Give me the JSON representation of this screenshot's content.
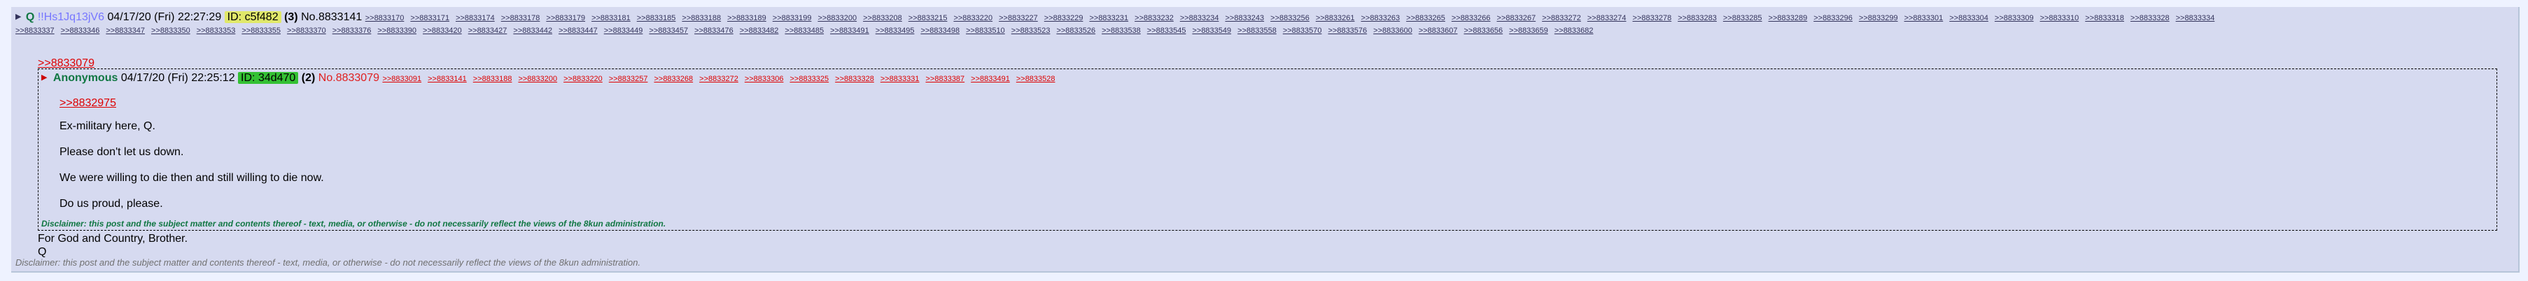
{
  "post": {
    "arrow": "▶",
    "name": "Q",
    "trip": "!!Hs1Jq13jV6",
    "date": "04/17/20 (Fri) 22:27:29",
    "id_label": "ID: c5f482",
    "reply_count": "(3)",
    "postno": "No.8833141",
    "backlinks": [
      ">>8833170",
      ">>8833171",
      ">>8833174",
      ">>8833178",
      ">>8833179",
      ">>8833181",
      ">>8833185",
      ">>8833188",
      ">>8833189",
      ">>8833199",
      ">>8833200",
      ">>8833208",
      ">>8833215",
      ">>8833220",
      ">>8833227",
      ">>8833229",
      ">>8833231",
      ">>8833232",
      ">>8833234",
      ">>8833243",
      ">>8833256",
      ">>8833261",
      ">>8833263",
      ">>8833265",
      ">>8833266",
      ">>8833267",
      ">>8833272",
      ">>8833274",
      ">>8833278",
      ">>8833283",
      ">>8833285",
      ">>8833289",
      ">>8833296",
      ">>8833299",
      ">>8833301",
      ">>8833304",
      ">>8833309",
      ">>8833310",
      ">>8833318",
      ">>8833328",
      ">>8833334"
    ],
    "backlinks_row2": [
      ">>8833337",
      ">>8833346",
      ">>8833347",
      ">>8833350",
      ">>8833353",
      ">>8833355",
      ">>8833370",
      ">>8833376",
      ">>8833390",
      ">>8833420",
      ">>8833427",
      ">>8833442",
      ">>8833447",
      ">>8833449",
      ">>8833457",
      ">>8833476",
      ">>8833482",
      ">>8833485",
      ">>8833491",
      ">>8833495",
      ">>8833498",
      ">>8833510",
      ">>8833523",
      ">>8833526",
      ">>8833538",
      ">>8833545",
      ">>8833549",
      ">>8833558",
      ">>8833570",
      ">>8833576",
      ">>8833600",
      ">>8833607",
      ">>8833656",
      ">>8833659",
      ">>8833682"
    ],
    "quote_link": ">>8833079",
    "body": [
      "For God and Country, Brother.",
      "Q"
    ],
    "disclaimer": "Disclaimer: this post and the subject matter and contents thereof - text, media, or otherwise - do not necessarily reflect the views of the 8kun administration."
  },
  "quoted": {
    "arrow": "▶",
    "name": "Anonymous",
    "date": "04/17/20 (Fri) 22:25:12",
    "id_label": "ID: 34d470",
    "reply_count": "(2)",
    "postno": "No.8833079",
    "backlinks": [
      ">>8833091",
      ">>8833141",
      ">>8833188",
      ">>8833200",
      ">>8833220",
      ">>8833257",
      ">>8833268",
      ">>8833272",
      ">>8833306",
      ">>8833325",
      ">>8833328",
      ">>8833331",
      ">>8833387",
      ">>8833491",
      ">>8833528"
    ],
    "quote_link": ">>8832975",
    "body": [
      "Ex-military here, Q.",
      "Please don't let us down.",
      "We were willing to die then and still willing to die now.",
      "Do us proud, please."
    ],
    "disclaimer": "Disclaimer: this post and the subject matter and contents thereof - text, media, or otherwise - do not necessarily reflect the views of the 8kun administration."
  }
}
